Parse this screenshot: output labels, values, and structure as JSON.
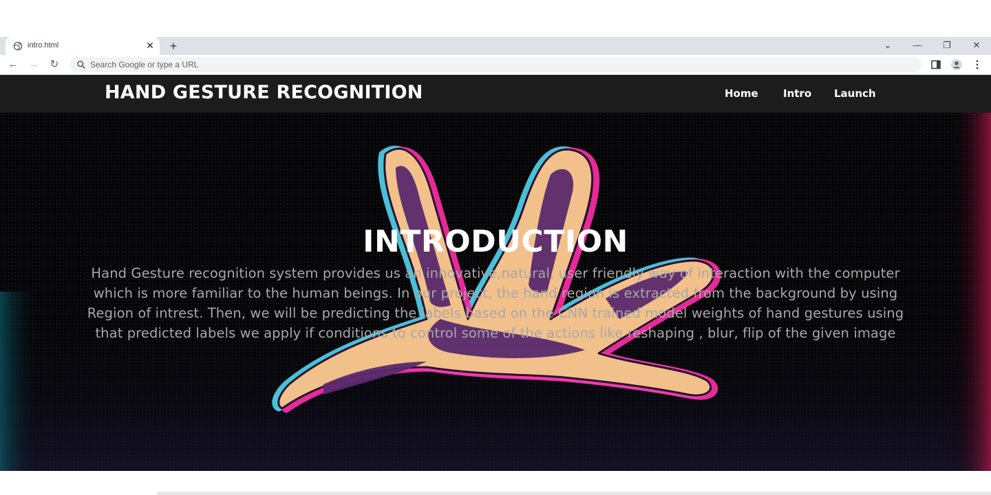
{
  "browser": {
    "tab": {
      "title": "intro.html",
      "close_glyph": "✕",
      "favicon": "globe-icon"
    },
    "new_tab_glyph": "+",
    "window_controls": {
      "tab_search": "⌄",
      "minimize": "—",
      "restore": "❐",
      "close": "✕"
    },
    "nav": {
      "back": "←",
      "forward": "→",
      "reload": "↻"
    },
    "omnibox": {
      "placeholder": "Search Google or type a URL",
      "value": ""
    },
    "toolbar_icons": [
      "side-panel-icon",
      "profile-icon",
      "menu-kebab-icon"
    ]
  },
  "site": {
    "brand": "HAND GESTURE RECOGNITION",
    "nav": [
      {
        "label": "Home"
      },
      {
        "label": "Intro"
      },
      {
        "label": "Launch"
      }
    ]
  },
  "hero": {
    "title": "INTRODUCTION",
    "lines": [
      "Hand Gesture recognition system provides us an innovative,natural, user friendly way of interaction with the computer",
      "which is more familiar to the human beings. In our project, the hand region is extracted from the background by using",
      "Region of intrest. Then, we will be predicting the labels based on the CNN trained model weights of hand gestures using",
      "that predicted labels we apply if conditions to control some of the actions like reshaping , blur, flip of the given image"
    ],
    "background_image": "neon-hand-illustration"
  },
  "colors": {
    "chrome_strip": "#dee1e6",
    "header_bg": "#1c1c1c",
    "hero_bg": "#050507",
    "hand_fill": "#f2c08a",
    "hand_inner": "#5a2a6e",
    "neon_pink": "#ff2fa8",
    "neon_cyan": "#4fd6f0",
    "body_text": "#a8a8a8"
  }
}
